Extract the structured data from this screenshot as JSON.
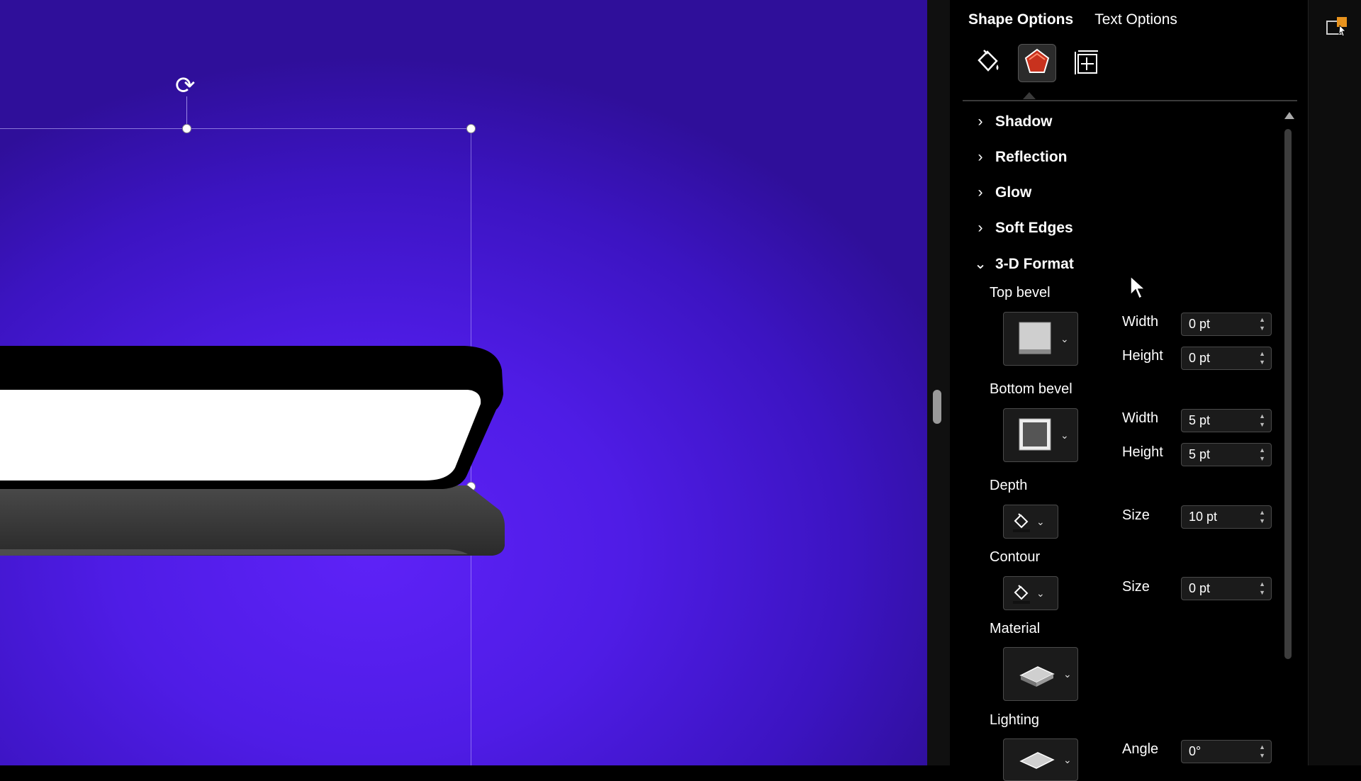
{
  "panel": {
    "tabs": [
      {
        "label": "Shape Options",
        "active": true
      },
      {
        "label": "Text Options",
        "active": false
      }
    ],
    "icons": [
      "fill-line-icon",
      "effects-icon",
      "size-properties-icon"
    ],
    "sections": [
      {
        "label": "Shadow",
        "expanded": false
      },
      {
        "label": "Reflection",
        "expanded": false
      },
      {
        "label": "Glow",
        "expanded": false
      },
      {
        "label": "Soft Edges",
        "expanded": false
      },
      {
        "label": "3-D Format",
        "expanded": true
      }
    ],
    "format3d": {
      "top_bevel": {
        "label": "Top bevel",
        "width_label": "Width",
        "width": "0 pt",
        "height_label": "Height",
        "height": "0 pt"
      },
      "bottom_bevel": {
        "label": "Bottom bevel",
        "width_label": "Width",
        "width": "5 pt",
        "height_label": "Height",
        "height": "5 pt"
      },
      "depth": {
        "label": "Depth",
        "size_label": "Size",
        "size": "10 pt"
      },
      "contour": {
        "label": "Contour",
        "size_label": "Size",
        "size": "0 pt"
      },
      "material": {
        "label": "Material"
      },
      "lighting": {
        "label": "Lighting",
        "angle_label": "Angle",
        "angle": "0°"
      }
    }
  },
  "colors": {
    "canvas": "#5020ea",
    "effects_icon_fill": "#c8321e",
    "panel_bg": "#000000"
  }
}
